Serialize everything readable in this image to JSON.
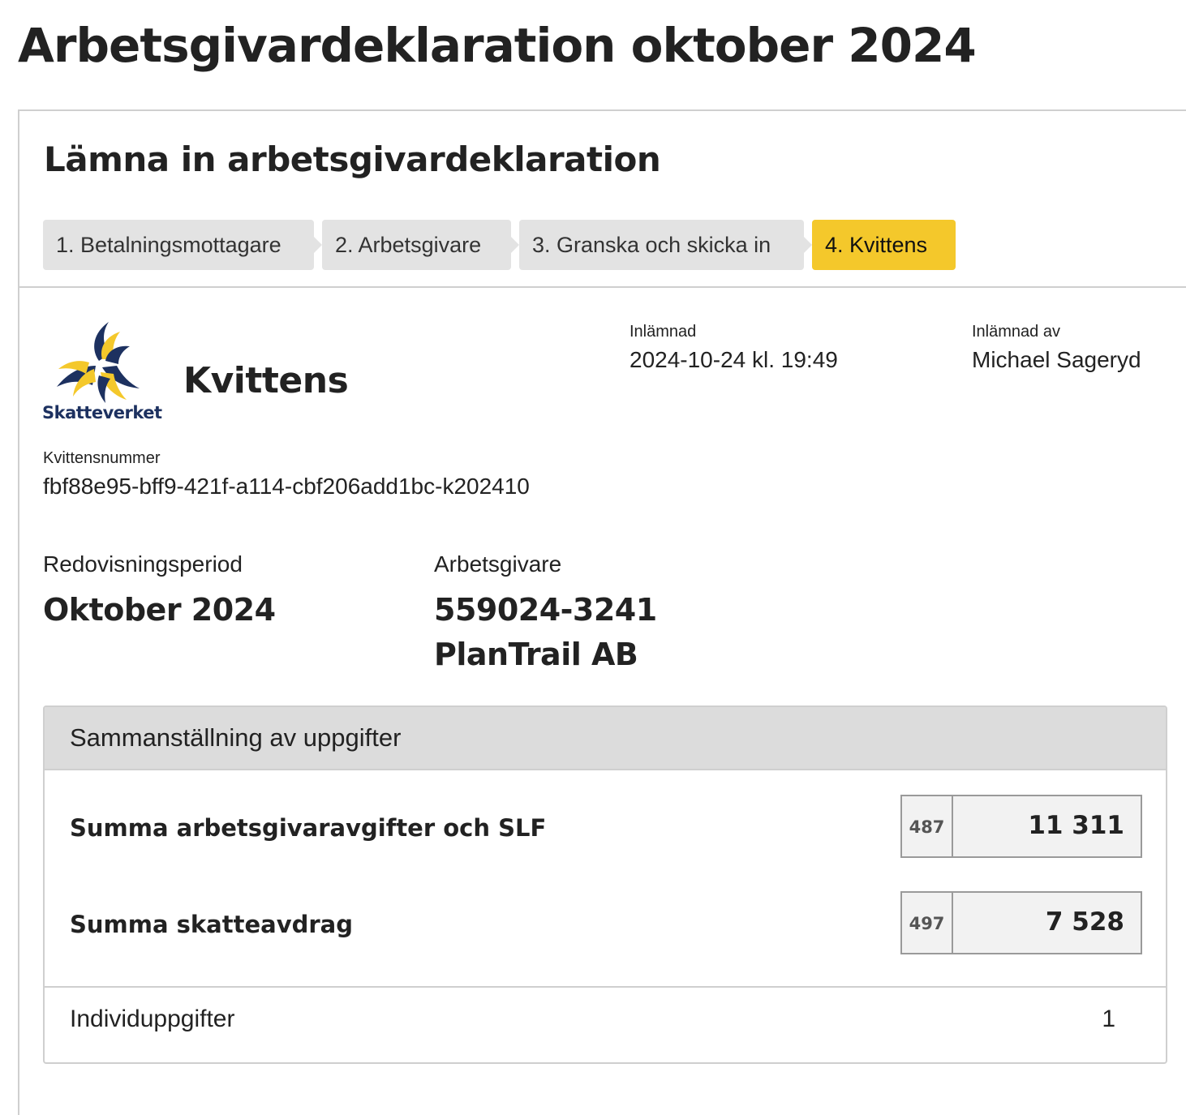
{
  "page": {
    "title": "Arbetsgivardeklaration oktober 2024"
  },
  "card": {
    "title": "Lämna in arbetsgivardeklaration"
  },
  "steps": [
    {
      "label": "1. Betalningsmottagare"
    },
    {
      "label": "2. Arbetsgivare"
    },
    {
      "label": "3. Granska och skicka in"
    },
    {
      "label": "4. Kvittens"
    }
  ],
  "colors": {
    "active_step": "#f4c82b",
    "step_bg": "#e3e3e3",
    "logo_navy": "#1d3160",
    "logo_yellow": "#f4c82b"
  },
  "receipt": {
    "logo_text": "Skatteverket",
    "heading": "Kvittens",
    "submitted_label": "Inlämnad",
    "submitted_value": "2024-10-24 kl. 19:49",
    "submitted_by_label": "Inlämnad av",
    "submitted_by_value": "Michael Sageryd",
    "number_label": "Kvittensnummer",
    "number_value": "fbf88e95-bff9-421f-a114-cbf206add1bc-k202410"
  },
  "period": {
    "label": "Redovisningsperiod",
    "value": "Oktober 2024"
  },
  "employer": {
    "label": "Arbetsgivare",
    "org_number": "559024-3241",
    "name": "PlanTrail AB"
  },
  "summary": {
    "title": "Sammanställning av uppgifter",
    "rows": [
      {
        "label": "Summa arbetsgivaravgifter och SLF",
        "code": "487",
        "value": "11 311"
      },
      {
        "label": "Summa skatteavdrag",
        "code": "497",
        "value": "7 528"
      }
    ],
    "individual_label": "Individuppgifter",
    "individual_value": "1"
  }
}
